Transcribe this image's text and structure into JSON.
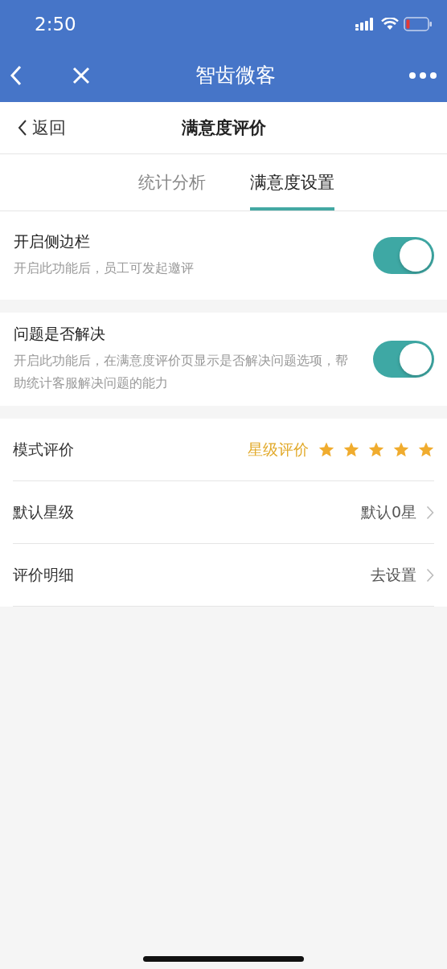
{
  "status_bar": {
    "time": "2:50"
  },
  "nav_bar": {
    "title": "智齿微客"
  },
  "header": {
    "back_label": "返回",
    "title": "满意度评价"
  },
  "tabs": [
    {
      "label": "统计分析",
      "selected": false
    },
    {
      "label": "满意度设置",
      "selected": true
    }
  ],
  "toggles": [
    {
      "title": "开启侧边栏",
      "description": "开启此功能后，员工可发起邀评",
      "on": true
    },
    {
      "title": "问题是否解决",
      "description": "开启此功能后，在满意度评价页显示是否解决问题选项，帮助统计客服解决问题的能力",
      "on": true
    }
  ],
  "settings": [
    {
      "kind": "stars",
      "label": "模式评价",
      "value": "星级评价",
      "stars": 5
    },
    {
      "kind": "link",
      "label": "默认星级",
      "value": "默认0星"
    },
    {
      "kind": "link",
      "label": "评价明细",
      "value": "去设置"
    }
  ]
}
